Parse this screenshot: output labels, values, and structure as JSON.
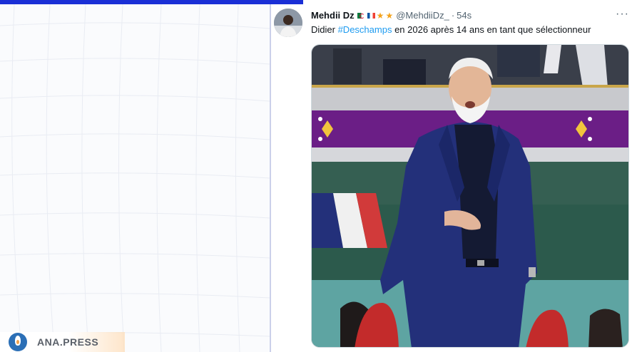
{
  "tweet": {
    "display_name": "Mehdii Dz",
    "handle": "@MehdiiDz_",
    "separator": "·",
    "time": "54s",
    "more_label": "···",
    "text_before": "Didier ",
    "hashtag": "#Deschamps",
    "text_after": " en 2026 après 14 ans en tant que sélectionneur",
    "media_alt": "Didier Deschamps on the touchline in a navy suit"
  },
  "watermark": {
    "label": "ANA.PRESS"
  },
  "colors": {
    "accent_bar": "#1a2fd6",
    "hashtag": "#1d9bf0",
    "muted_text": "#536471",
    "suit": "#23307a",
    "stadium_purple": "#6b1e86"
  },
  "icons": {
    "avatar": "user-avatar",
    "flag_1": "algeria-flag-icon",
    "flag_2": "france-flag-icon",
    "star_1": "star-icon",
    "star_2": "star-icon",
    "more": "more-options-icon",
    "watermark_logo": "ana-press-logo-icon"
  }
}
